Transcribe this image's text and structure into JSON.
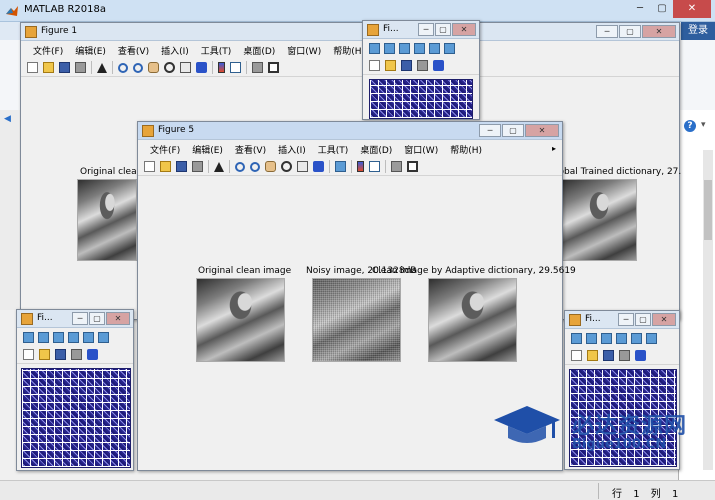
{
  "app": {
    "title": "MATLAB R2018a",
    "login_label": "登录",
    "window_controls": [
      "─",
      "▢",
      "✕"
    ]
  },
  "statusbar": {
    "row_label": "行",
    "row_value": "1",
    "col_label": "列",
    "col_value": "1"
  },
  "figure_menu": [
    "文件(F)",
    "编辑(E)",
    "查看(V)",
    "插入(I)",
    "工具(T)",
    "桌面(D)",
    "窗口(W)",
    "帮助(H)"
  ],
  "figures": {
    "fig1": {
      "title": "Figure 1",
      "left_label": "Original clean",
      "right_label": "Global Trained dictionary, 27."
    },
    "fig5": {
      "title": "Figure 5",
      "label_clean": "Original clean image",
      "label_noisy": "Noisy image, 20.1328dB",
      "label_adaptive": "Clean image by Adaptive dictionary, 29.5619"
    },
    "fig_small_top": {
      "title": "Fi..."
    },
    "fig_small_left": {
      "title": "Fi..."
    },
    "fig_small_right": {
      "title": "Fi..."
    }
  },
  "watermark": {
    "title": "必达资源网",
    "site": "Bigue100.CN"
  },
  "icons": [
    "new-figure-icon",
    "open-file-icon",
    "save-icon",
    "print-icon",
    "pointer-icon",
    "zoom-in-icon",
    "zoom-out-icon",
    "pan-icon",
    "rotate-3d-icon",
    "data-cursor-icon",
    "brush-icon",
    "colorbar-icon",
    "legend-icon",
    "hide-plot-tools-icon",
    "show-plot-tools-icon"
  ],
  "colors": {
    "matlab_title": "#cfe1f3",
    "figure_active_title": "#c8daf0",
    "dictionary_blue": "#2a2a9a",
    "watermark_blue": "#1f4fa8"
  }
}
